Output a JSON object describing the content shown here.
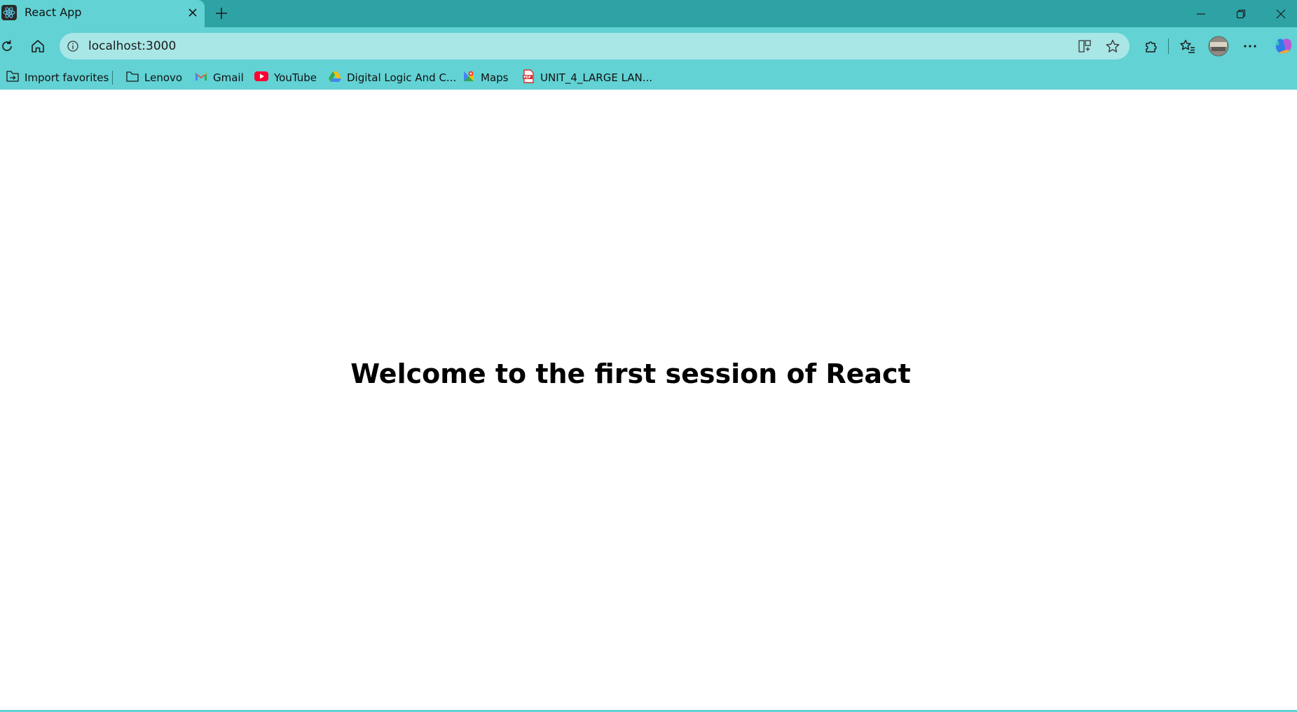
{
  "tab": {
    "title": "React App",
    "favicon": "react-icon"
  },
  "toolbar": {
    "url": "localhost:3000"
  },
  "bookmarks": [
    {
      "label": "Import favorites",
      "icon": "import-favorites-icon"
    },
    {
      "label": "Lenovo",
      "icon": "folder-icon"
    },
    {
      "label": "Gmail",
      "icon": "gmail-icon"
    },
    {
      "label": "YouTube",
      "icon": "youtube-icon"
    },
    {
      "label": "Digital Logic And C...",
      "icon": "google-drive-icon"
    },
    {
      "label": "Maps",
      "icon": "maps-icon"
    },
    {
      "label": "UNIT_4_LARGE LAN...",
      "icon": "pdf-icon"
    }
  ],
  "page": {
    "heading": "Welcome to the first session of React"
  },
  "colors": {
    "tab_strip": "#2ea3a6",
    "toolbar": "#62d2d4",
    "address_bar": "#a9e6e6",
    "page_background": "#ffffff"
  }
}
